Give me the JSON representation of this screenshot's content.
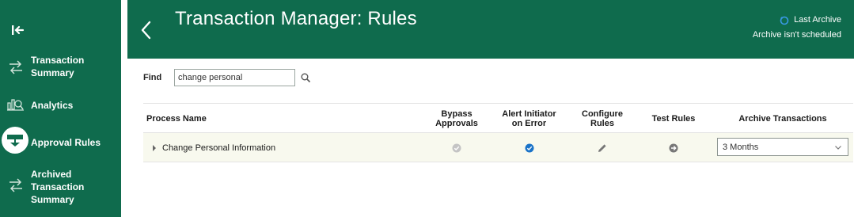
{
  "sidebar": {
    "items": [
      {
        "label_line1": "Transaction",
        "label_line2": "Summary",
        "icon": "swap-arrows-icon"
      },
      {
        "label": "Analytics",
        "icon": "analytics-icon"
      },
      {
        "label": "Approval Rules",
        "icon": "approval-rules-icon",
        "active": true
      },
      {
        "label_line1": "Archived",
        "label_line2": "Transaction",
        "label_line3": "Summary",
        "icon": "swap-arrows-icon"
      }
    ]
  },
  "header": {
    "title": "Transaction Manager: Rules",
    "archive_link": "Last Archive",
    "archive_status": "Archive isn't scheduled"
  },
  "find": {
    "label": "Find",
    "value": "change personal"
  },
  "table": {
    "columns": {
      "process_name": "Process Name",
      "bypass_line1": "Bypass",
      "bypass_line2": "Approvals",
      "alert_line1": "Alert Initiator",
      "alert_line2": "on Error",
      "configure_line1": "Configure",
      "configure_line2": "Rules",
      "test_rules": "Test Rules",
      "archive": "Archive Transactions"
    },
    "rows": [
      {
        "process_name": "Change Personal Information",
        "bypass_approvals": false,
        "alert_initiator": true,
        "archive_value": "3 Months"
      }
    ]
  },
  "colors": {
    "brand_green": "#0f6b4d",
    "row_highlight": "#f8f9ee",
    "check_blue": "#1a73c8",
    "check_gray": "#c4c4c4"
  }
}
